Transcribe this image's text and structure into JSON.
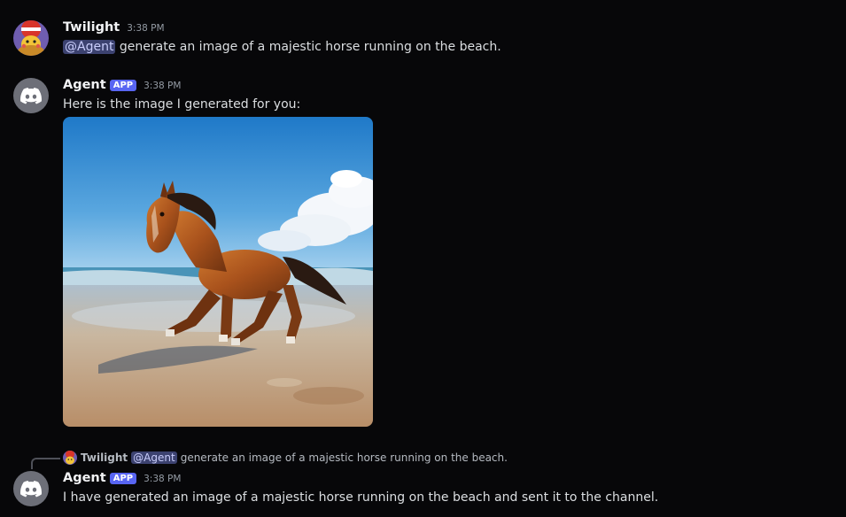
{
  "messages": [
    {
      "author": "Twilight",
      "timestamp": "3:38 PM",
      "mention": "@Agent",
      "text": "generate an image of a majestic horse running on the beach."
    },
    {
      "author": "Agent",
      "tag": "APP",
      "timestamp": "3:38 PM",
      "text": "Here is the image I generated for you:",
      "attachment": {
        "icon": "generated-horse-beach-image"
      }
    },
    {
      "author": "Agent",
      "tag": "APP",
      "timestamp": "3:38 PM",
      "reply_to": {
        "author": "Twilight",
        "mention": "@Agent",
        "text": "generate an image of a majestic horse running on the beach."
      },
      "text": "I have generated an image of a majestic horse running on the beach and sent it to the channel."
    }
  ],
  "colors": {
    "background": "#070709",
    "app_tag": "#5865f2",
    "mention_bg": "#3c4270",
    "bot_avatar_bg": "#6d6f78"
  }
}
